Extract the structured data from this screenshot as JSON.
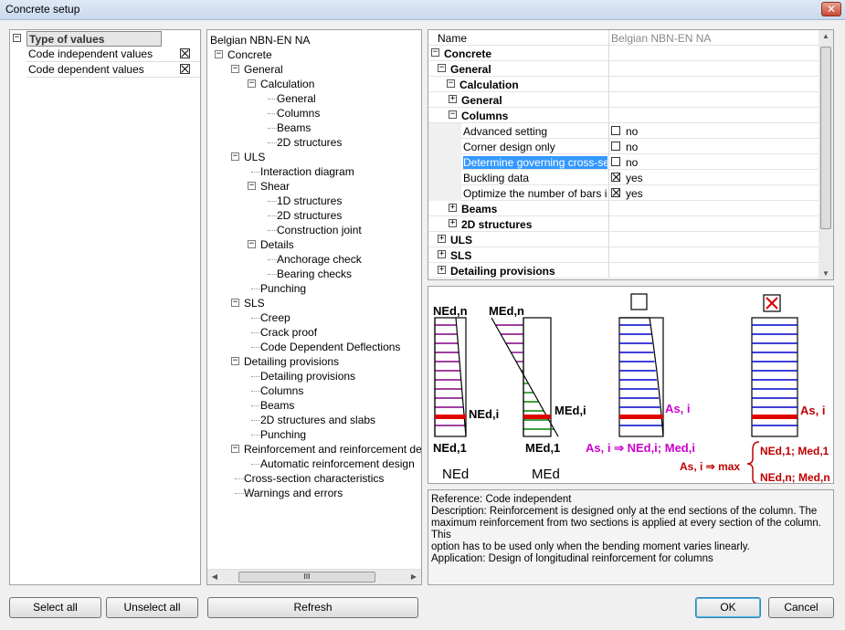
{
  "window": {
    "title": "Concrete setup",
    "close_glyph": "✕"
  },
  "left_panel": {
    "header": "Type of values",
    "rows": [
      {
        "label": "Code independent values",
        "checked": true
      },
      {
        "label": "Code dependent values",
        "checked": true
      }
    ]
  },
  "tree": {
    "root": "Belgian NBN-EN NA",
    "items": [
      {
        "label": "Concrete",
        "level": 0,
        "exp": "−"
      },
      {
        "label": "General",
        "level": 1,
        "exp": "−"
      },
      {
        "label": "Calculation",
        "level": 2,
        "exp": "−"
      },
      {
        "label": "General",
        "level": 3
      },
      {
        "label": "Columns",
        "level": 3
      },
      {
        "label": "Beams",
        "level": 3
      },
      {
        "label": "2D structures",
        "level": 3
      },
      {
        "label": "ULS",
        "level": 1,
        "exp": "−"
      },
      {
        "label": "Interaction diagram",
        "level": 2
      },
      {
        "label": "Shear",
        "level": 2,
        "exp": "−"
      },
      {
        "label": "1D structures",
        "level": 3
      },
      {
        "label": "2D structures",
        "level": 3
      },
      {
        "label": "Construction joint",
        "level": 3
      },
      {
        "label": "Details",
        "level": 2,
        "exp": "−"
      },
      {
        "label": "Anchorage check",
        "level": 3
      },
      {
        "label": "Bearing checks",
        "level": 3
      },
      {
        "label": "Punching",
        "level": 2
      },
      {
        "label": "SLS",
        "level": 1,
        "exp": "−"
      },
      {
        "label": "Creep",
        "level": 2
      },
      {
        "label": "Crack proof",
        "level": 2
      },
      {
        "label": "Code Dependent Deflections",
        "level": 2
      },
      {
        "label": "Detailing provisions",
        "level": 1,
        "exp": "−"
      },
      {
        "label": "Detailing provisions",
        "level": 2
      },
      {
        "label": "Columns",
        "level": 2
      },
      {
        "label": "Beams",
        "level": 2
      },
      {
        "label": "2D structures and slabs",
        "level": 2
      },
      {
        "label": "Punching",
        "level": 2
      },
      {
        "label": "Reinforcement and reinforcement design",
        "level": 1,
        "exp": "−"
      },
      {
        "label": "Automatic reinforcement design",
        "level": 2
      },
      {
        "label": "Cross-section characteristics",
        "level": 1
      },
      {
        "label": "Warnings and errors",
        "level": 1
      }
    ],
    "scroll_thumb_glyph": "III"
  },
  "grid": {
    "header_name": "Name",
    "header_value": "Belgian NBN-EN NA",
    "rows": [
      {
        "name": "Concrete",
        "level": 0,
        "exp": "−",
        "bold": true
      },
      {
        "name": "General",
        "level": 1,
        "exp": "−",
        "bold": true
      },
      {
        "name": "Calculation",
        "level": 2,
        "exp": "−",
        "bold": true
      },
      {
        "name": "General",
        "level": 3,
        "exp": "+",
        "bold": true
      },
      {
        "name": "Columns",
        "level": 3,
        "exp": "−",
        "bold": true
      },
      {
        "name": "Advanced setting",
        "level": 4,
        "check": false,
        "value": "no"
      },
      {
        "name": "Corner design only",
        "level": 4,
        "check": false,
        "value": "no"
      },
      {
        "name": "Determine governing cross-sec...",
        "level": 4,
        "check": false,
        "value": "no",
        "highlight": true
      },
      {
        "name": "Buckling data",
        "level": 4,
        "check": true,
        "value": "yes"
      },
      {
        "name": "Optimize the number of bars in ...",
        "level": 4,
        "check": true,
        "value": "yes"
      },
      {
        "name": "Beams",
        "level": 3,
        "exp": "+",
        "bold": true
      },
      {
        "name": "2D structures",
        "level": 3,
        "exp": "+",
        "bold": true
      },
      {
        "name": "ULS",
        "level": 1,
        "exp": "+",
        "bold": true
      },
      {
        "name": "SLS",
        "level": 1,
        "exp": "+",
        "bold": true
      },
      {
        "name": "Detailing provisions",
        "level": 1,
        "exp": "+",
        "bold": true
      }
    ]
  },
  "diagram": {
    "ned_top": "NEd,n",
    "ned_mid": "NEd,i",
    "ned_bot": "NEd,1",
    "ned_caption": "NEd",
    "med_top": "MEd,n",
    "med_mid": "MEd,i",
    "med_bot": "MEd,1",
    "med_caption": "MEd",
    "as_i_1": "As, i",
    "as_i_formula": "As, i ⇒ NEd,i; Med,i",
    "as_i_2": "As, i",
    "as_max": "As, i ⇒ max",
    "ned1_med1": "NEd,1; Med,1",
    "nedn_medn": "NEd,n; Med,n",
    "colors": {
      "purple": "#800080",
      "green": "#008000",
      "blue": "#0000cc",
      "red": "#e00000",
      "magenta": "#cc00cc",
      "darkred": "#c00000"
    }
  },
  "description": {
    "reference": "Reference:  Code independent",
    "line1": "Description:  Reinforcement is designed only at the end sections of the column. The",
    "line2": "maximum reinforcement from two sections is applied at every section of the column.  This",
    "line3": "option has to be used only when the bending moment varies linearly.",
    "application": "Application:  Design of longitudinal reinforcement for columns"
  },
  "buttons": {
    "select_all": "Select all",
    "unselect_all": "Unselect all",
    "refresh": "Refresh",
    "ok": "OK",
    "cancel": "Cancel"
  }
}
